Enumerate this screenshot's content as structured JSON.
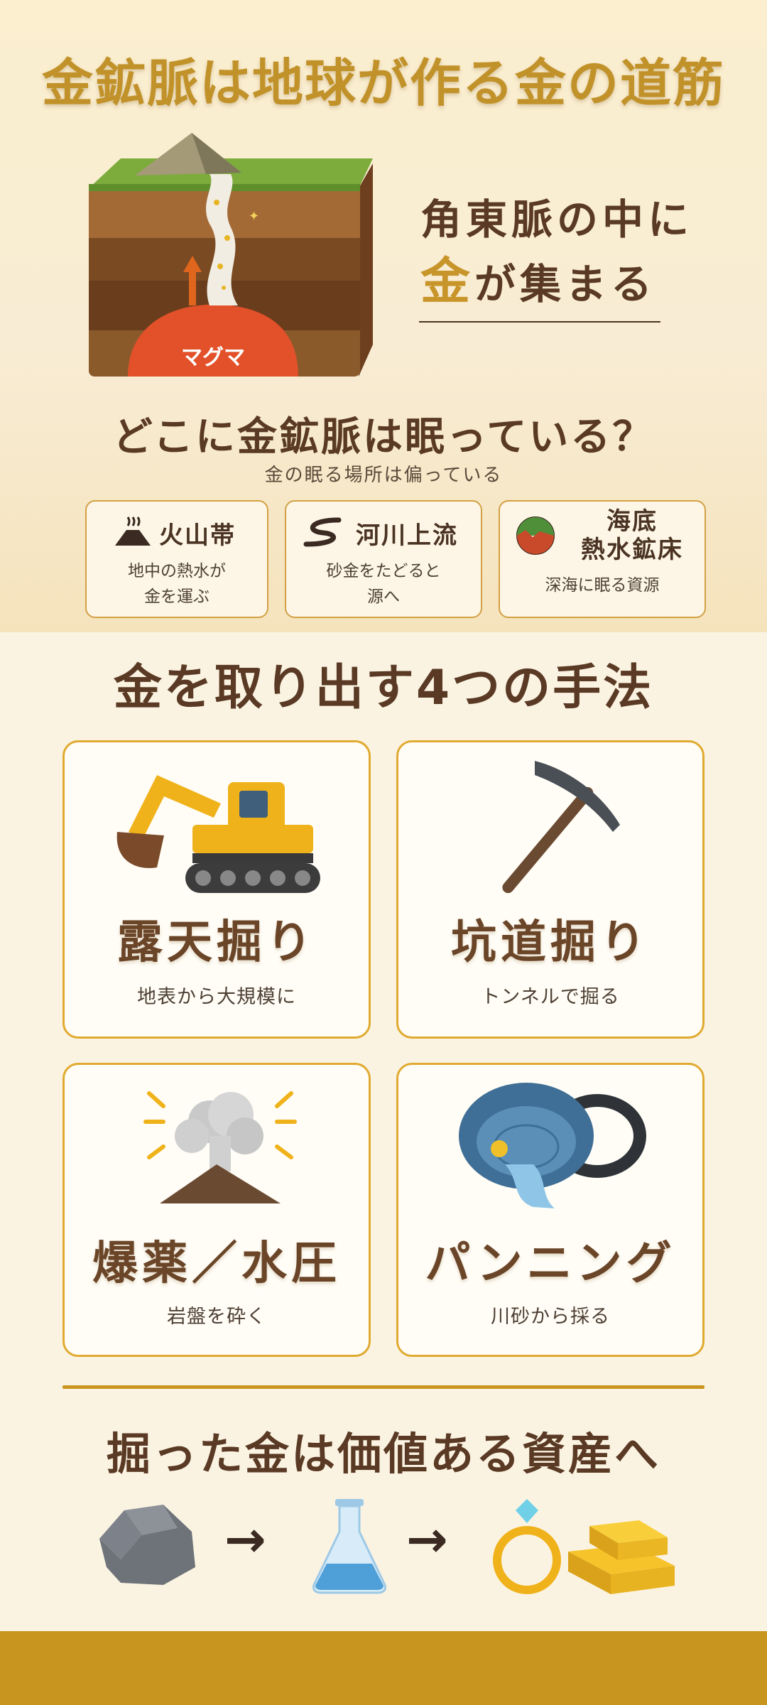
{
  "title": "金鉱脈は地球が作る金の道筋",
  "hero": {
    "magma_label": "マグマ",
    "headline_line1": "角東脈の中に",
    "headline_gold": "金",
    "headline_rest": "が集まる"
  },
  "where": {
    "title": "どこに金鉱脈は眠っている？",
    "subtitle": "金の眠る場所は偏っている",
    "cards": [
      {
        "title": "火山帯",
        "desc": "地中の熱水が\n金を運ぶ",
        "icon": "volcano-icon"
      },
      {
        "title": "河川上流",
        "desc": "砂金をたどると\n源へ",
        "icon": "river-icon"
      },
      {
        "title": "海底\n熱水鉱床",
        "desc": "深海に眠る資源",
        "icon": "seafloor-icon"
      }
    ]
  },
  "methods": {
    "title": "金を取り出す4つの手法",
    "items": [
      {
        "title": "露天掘り",
        "desc": "地表から大規模に",
        "icon": "excavator-icon"
      },
      {
        "title": "坑道掘り",
        "desc": "トンネルで掘る",
        "icon": "pickaxe-icon"
      },
      {
        "title": "爆薬／水圧",
        "desc": "岩盤を砕く",
        "icon": "explosion-icon"
      },
      {
        "title": "パンニング",
        "desc": "川砂から採る",
        "icon": "gold-pan-icon"
      }
    ]
  },
  "value": {
    "title": "掘った金は価値ある資産へ",
    "arrow": "→"
  },
  "colors": {
    "gold": "#c8952a",
    "brown": "#5a3a24",
    "band": "#c8961f"
  }
}
